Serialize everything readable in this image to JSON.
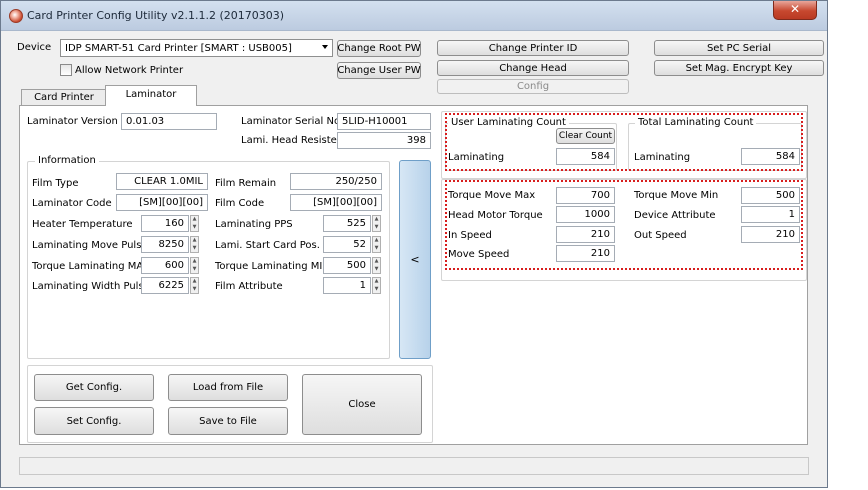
{
  "window": {
    "title": "Card Printer Config Utility v2.1.1.2 (20170303)",
    "close_glyph": "✕"
  },
  "device": {
    "label": "Device",
    "selected": "IDP SMART-51 Card Printer  [SMART : USB005]",
    "allow_network_label": "Allow Network Printer",
    "allow_network_checked": false
  },
  "top_buttons": {
    "change_root_pw": "Change Root PW",
    "change_user_pw": "Change User PW",
    "change_printer_id": "Change Printer ID",
    "change_head": "Change Head",
    "config": "Config",
    "set_pc_serial": "Set PC Serial",
    "set_mag_encrypt_key": "Set Mag. Encrypt Key"
  },
  "tabs": [
    {
      "label": "Card Printer"
    },
    {
      "label": "Laminator"
    }
  ],
  "laminator": {
    "version_label": "Laminator Version",
    "version": "0.01.03",
    "serial_label": "Laminator Serial No.",
    "serial": "5LID-H10001",
    "head_resister_label": "Lami. Head Resister",
    "head_resister": "398"
  },
  "information": {
    "title": "Information",
    "left": [
      {
        "label": "Film Type",
        "value": "CLEAR 1.0MIL"
      },
      {
        "label": "Laminator Code",
        "value": "[SM][00][00]"
      },
      {
        "label": "Heater Temperature",
        "value": "160"
      },
      {
        "label": "Laminating Move Pulse",
        "value": "8250"
      },
      {
        "label": "Torque Laminating MAX",
        "value": "600"
      },
      {
        "label": "Laminating Width Pulse",
        "value": "6225"
      }
    ],
    "right": [
      {
        "label": "Film Remain",
        "value": "250/250"
      },
      {
        "label": "Film Code",
        "value": "[SM][00][00]"
      },
      {
        "label": "Laminating PPS",
        "value": "525"
      },
      {
        "label": "Lami. Start Card Pos.",
        "value": "52"
      },
      {
        "label": "Torque Laminating MIN",
        "value": "500"
      },
      {
        "label": "Film Attribute",
        "value": "1"
      }
    ]
  },
  "arrow_button": "<",
  "actions": {
    "get_config": "Get Config.",
    "set_config": "Set Config.",
    "load_from_file": "Load from File",
    "save_to_file": "Save to File",
    "close": "Close"
  },
  "user_count": {
    "title": "User Laminating Count",
    "clear": "Clear Count",
    "label": "Laminating",
    "value": "584"
  },
  "total_count": {
    "title": "Total Laminating Count",
    "label": "Laminating",
    "value": "584"
  },
  "torque": {
    "left": [
      {
        "label": "Torque Move Max",
        "value": "700"
      },
      {
        "label": "Head Motor Torque",
        "value": "1000"
      },
      {
        "label": "In Speed",
        "value": "210"
      },
      {
        "label": "Move Speed",
        "value": "210"
      }
    ],
    "right": [
      {
        "label": "Torque Move Min",
        "value": "500"
      },
      {
        "label": "Device Attribute",
        "value": "1"
      },
      {
        "label": "Out Speed",
        "value": "210"
      }
    ]
  },
  "colors": {
    "highlight": "#d81e1e",
    "arrow_button": "#c6dcee"
  }
}
